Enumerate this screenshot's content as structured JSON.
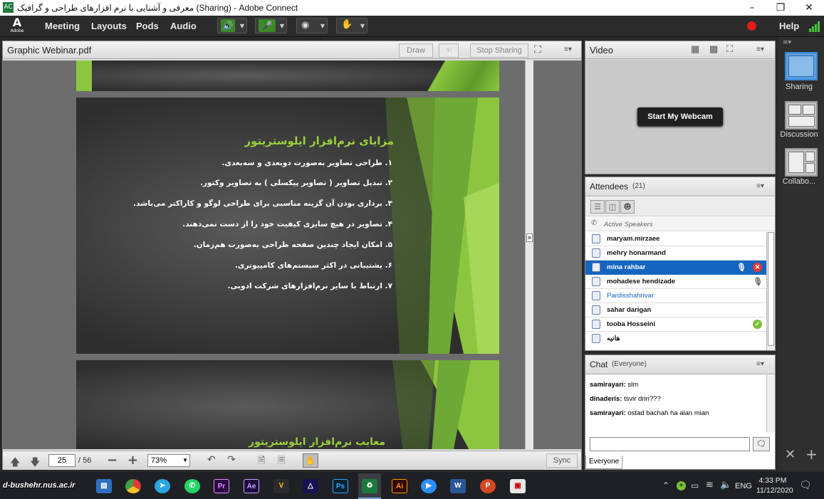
{
  "window": {
    "title": "معرفی و آشنایی با نرم افزارهای طراحی و گرافیک (Sharing) - Adobe Connect",
    "app_icon_label": "AC"
  },
  "menubar": {
    "logo_text": "Adobe",
    "items": [
      "Meeting",
      "Layouts",
      "Pods",
      "Audio"
    ],
    "help": "Help"
  },
  "share_pod": {
    "title": "Graphic Webinar.pdf",
    "draw_label": "Draw",
    "stop_sharing_label": "Stop Sharing",
    "page_current": "25",
    "page_total": "/ 56",
    "zoom": "73%",
    "sync_label": "Sync"
  },
  "slide": {
    "title": "مزایای نرم‌افزار ایلوستریتور",
    "items": [
      "۱. طراحی تصاویر به‌صورت دوبعدی و سه‌بعدی.",
      "۲. تبدیل تصاویر ( تصاویر پیکسلی ) به تصاویر وکتور.",
      "۳. برداری بودن آن گزینه مناسبی برای طراحی لوگو و کاراکتر می‌باشد.",
      "۴. تصاویر در هیچ سایزی کیفیت خود را از دست نمی‌دهند.",
      "۵. امکان ایجاد چندین صفحه طراحی به‌صورت هم‌زمان.",
      "۶. پشتیبانی در اکثر سیستم‌های کامپیوتری.",
      "۷. ارتباط با سایر نرم‌افزارهای شرکت ادوبی."
    ],
    "next_title": "معایب نرم‌افزار ایلوستریتور"
  },
  "video_pod": {
    "title": "Video",
    "webcam_button": "Start My Webcam"
  },
  "attendees_pod": {
    "title": "Attendees",
    "count": "(21)",
    "active_speakers": "Active Speakers",
    "list": [
      {
        "name": "maryam.mirzaee"
      },
      {
        "name": "mehry honarmand"
      },
      {
        "name": "mina rahbar"
      },
      {
        "name": "mohadese hendizade"
      },
      {
        "name": "Pardisshahrivar"
      },
      {
        "name": "sahar darigan"
      },
      {
        "name": "tooba Hosseini"
      },
      {
        "name": "هانیه"
      }
    ]
  },
  "chat_pod": {
    "title": "Chat",
    "scope": "(Everyone)",
    "messages": [
      {
        "user": "samirayari:",
        "text": "slm"
      },
      {
        "user": "dinaderis:",
        "text": "tsvir drin???"
      },
      {
        "user": "samirayari:",
        "text": "ostad bachah ha alan mian"
      }
    ],
    "recipient_tab": "Everyone"
  },
  "layouts": {
    "items": [
      "Sharing",
      "Discussion",
      "Collabo..."
    ]
  },
  "taskbar": {
    "watermark": "d-bushehr.nus.ac.ir",
    "lang": "ENG",
    "time": "4:33 PM",
    "date": "11/12/2020",
    "apps": [
      "Pr",
      "Ae",
      "Ai",
      "Ps"
    ]
  },
  "colors": {
    "accent_blue": "#1565c0",
    "slide_green": "#8cc63f",
    "slide_title": "#9bd13a"
  }
}
